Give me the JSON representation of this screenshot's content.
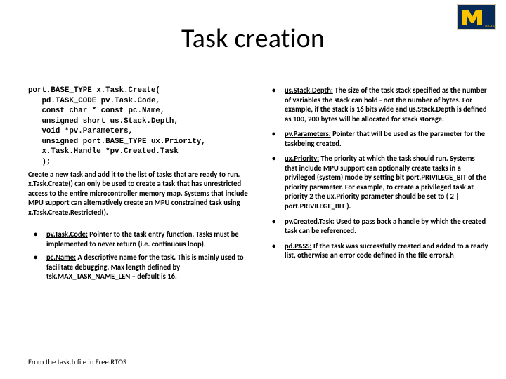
{
  "title": "Task creation",
  "logo": {
    "name": "michigan-m-logo"
  },
  "left": {
    "code": "port.BASE_TYPE x.Task.Create(\n   pd.TASK_CODE pv.Task.Code,\n   const char * const pc.Name,\n   unsigned short us.Stack.Depth,\n   void *pv.Parameters,\n   unsigned port.BASE_TYPE ux.Priority,\n   x.Task.Handle *pv.Created.Task\n   );",
    "desc": "Create a new task and add it to the list of tasks that are ready to run.  x.Task.Create() can only be used to create a task that has unrestricted access to the entire microcontroller memory map.  Systems that include MPU support can alternatively create an MPU constrained task using x.Task.Create.Restricted().",
    "bullets": [
      {
        "term": "pv.Task.Code:",
        "text": " Pointer to the task entry function. Tasks must be implemented to never return (i.e. continuous loop)."
      },
      {
        "term": "pc.Name:",
        "text": " A descriptive name for the task.  This is mainly used to facilitate debugging.  Max length defined by tsk.MAX_TASK_NAME_LEN – default is 16."
      }
    ]
  },
  "right": {
    "bullets": [
      {
        "term": "us.Stack.Depth:",
        "text": " The size of the task stack specified as the number of variables the stack can hold - not the number of bytes.  For example, if the stack is 16 bits wide and us.Stack.Depth is defined as 100, 200 bytes will be allocated for stack storage."
      },
      {
        "term": "pv.Parameters:",
        "text": " Pointer that will be used as the parameter for the taskbeing created."
      },
      {
        "term": "ux.Priority:",
        "text": " The priority at which the task should run.  Systems that include MPU support can optionally create tasks in a privileged (system) mode by setting bit port.PRIVILEGE_BIT of the priority parameter.  For example, to create a privileged task at priority 2 the ux.Priority parameter should be set to ( 2 | port.PRIVILEGE_BIT )."
      },
      {
        "term": "pv.Created.Task:",
        "text": " Used to pass back a handle by which the created task can be referenced."
      },
      {
        "term": "pd.PASS:",
        "text": " If the task was successfully created and added to a ready list, otherwise an error code defined in the file errors.h"
      }
    ]
  },
  "footer": "From the task.h file in Free.RTOS"
}
